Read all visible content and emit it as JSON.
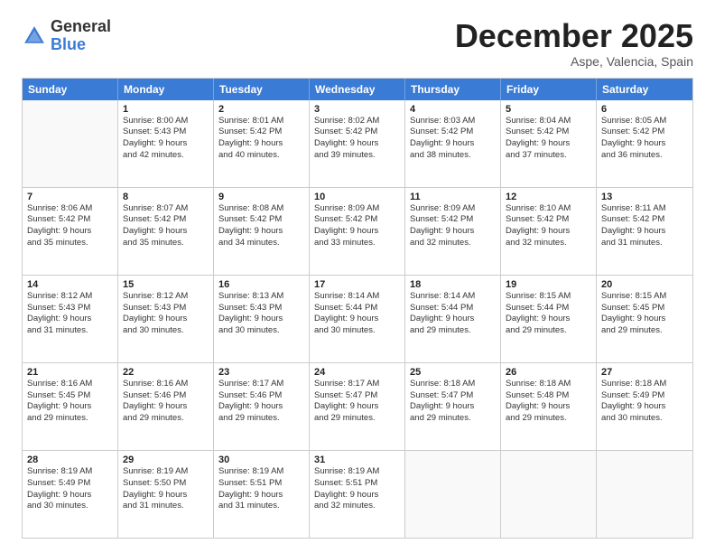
{
  "logo": {
    "general": "General",
    "blue": "Blue"
  },
  "title": "December 2025",
  "location": "Aspe, Valencia, Spain",
  "days_header": [
    "Sunday",
    "Monday",
    "Tuesday",
    "Wednesday",
    "Thursday",
    "Friday",
    "Saturday"
  ],
  "weeks": [
    [
      {
        "day": "",
        "info": ""
      },
      {
        "day": "1",
        "info": "Sunrise: 8:00 AM\nSunset: 5:43 PM\nDaylight: 9 hours\nand 42 minutes."
      },
      {
        "day": "2",
        "info": "Sunrise: 8:01 AM\nSunset: 5:42 PM\nDaylight: 9 hours\nand 40 minutes."
      },
      {
        "day": "3",
        "info": "Sunrise: 8:02 AM\nSunset: 5:42 PM\nDaylight: 9 hours\nand 39 minutes."
      },
      {
        "day": "4",
        "info": "Sunrise: 8:03 AM\nSunset: 5:42 PM\nDaylight: 9 hours\nand 38 minutes."
      },
      {
        "day": "5",
        "info": "Sunrise: 8:04 AM\nSunset: 5:42 PM\nDaylight: 9 hours\nand 37 minutes."
      },
      {
        "day": "6",
        "info": "Sunrise: 8:05 AM\nSunset: 5:42 PM\nDaylight: 9 hours\nand 36 minutes."
      }
    ],
    [
      {
        "day": "7",
        "info": "Sunrise: 8:06 AM\nSunset: 5:42 PM\nDaylight: 9 hours\nand 35 minutes."
      },
      {
        "day": "8",
        "info": "Sunrise: 8:07 AM\nSunset: 5:42 PM\nDaylight: 9 hours\nand 35 minutes."
      },
      {
        "day": "9",
        "info": "Sunrise: 8:08 AM\nSunset: 5:42 PM\nDaylight: 9 hours\nand 34 minutes."
      },
      {
        "day": "10",
        "info": "Sunrise: 8:09 AM\nSunset: 5:42 PM\nDaylight: 9 hours\nand 33 minutes."
      },
      {
        "day": "11",
        "info": "Sunrise: 8:09 AM\nSunset: 5:42 PM\nDaylight: 9 hours\nand 32 minutes."
      },
      {
        "day": "12",
        "info": "Sunrise: 8:10 AM\nSunset: 5:42 PM\nDaylight: 9 hours\nand 32 minutes."
      },
      {
        "day": "13",
        "info": "Sunrise: 8:11 AM\nSunset: 5:42 PM\nDaylight: 9 hours\nand 31 minutes."
      }
    ],
    [
      {
        "day": "14",
        "info": "Sunrise: 8:12 AM\nSunset: 5:43 PM\nDaylight: 9 hours\nand 31 minutes."
      },
      {
        "day": "15",
        "info": "Sunrise: 8:12 AM\nSunset: 5:43 PM\nDaylight: 9 hours\nand 30 minutes."
      },
      {
        "day": "16",
        "info": "Sunrise: 8:13 AM\nSunset: 5:43 PM\nDaylight: 9 hours\nand 30 minutes."
      },
      {
        "day": "17",
        "info": "Sunrise: 8:14 AM\nSunset: 5:44 PM\nDaylight: 9 hours\nand 30 minutes."
      },
      {
        "day": "18",
        "info": "Sunrise: 8:14 AM\nSunset: 5:44 PM\nDaylight: 9 hours\nand 29 minutes."
      },
      {
        "day": "19",
        "info": "Sunrise: 8:15 AM\nSunset: 5:44 PM\nDaylight: 9 hours\nand 29 minutes."
      },
      {
        "day": "20",
        "info": "Sunrise: 8:15 AM\nSunset: 5:45 PM\nDaylight: 9 hours\nand 29 minutes."
      }
    ],
    [
      {
        "day": "21",
        "info": "Sunrise: 8:16 AM\nSunset: 5:45 PM\nDaylight: 9 hours\nand 29 minutes."
      },
      {
        "day": "22",
        "info": "Sunrise: 8:16 AM\nSunset: 5:46 PM\nDaylight: 9 hours\nand 29 minutes."
      },
      {
        "day": "23",
        "info": "Sunrise: 8:17 AM\nSunset: 5:46 PM\nDaylight: 9 hours\nand 29 minutes."
      },
      {
        "day": "24",
        "info": "Sunrise: 8:17 AM\nSunset: 5:47 PM\nDaylight: 9 hours\nand 29 minutes."
      },
      {
        "day": "25",
        "info": "Sunrise: 8:18 AM\nSunset: 5:47 PM\nDaylight: 9 hours\nand 29 minutes."
      },
      {
        "day": "26",
        "info": "Sunrise: 8:18 AM\nSunset: 5:48 PM\nDaylight: 9 hours\nand 29 minutes."
      },
      {
        "day": "27",
        "info": "Sunrise: 8:18 AM\nSunset: 5:49 PM\nDaylight: 9 hours\nand 30 minutes."
      }
    ],
    [
      {
        "day": "28",
        "info": "Sunrise: 8:19 AM\nSunset: 5:49 PM\nDaylight: 9 hours\nand 30 minutes."
      },
      {
        "day": "29",
        "info": "Sunrise: 8:19 AM\nSunset: 5:50 PM\nDaylight: 9 hours\nand 31 minutes."
      },
      {
        "day": "30",
        "info": "Sunrise: 8:19 AM\nSunset: 5:51 PM\nDaylight: 9 hours\nand 31 minutes."
      },
      {
        "day": "31",
        "info": "Sunrise: 8:19 AM\nSunset: 5:51 PM\nDaylight: 9 hours\nand 32 minutes."
      },
      {
        "day": "",
        "info": ""
      },
      {
        "day": "",
        "info": ""
      },
      {
        "day": "",
        "info": ""
      }
    ]
  ]
}
